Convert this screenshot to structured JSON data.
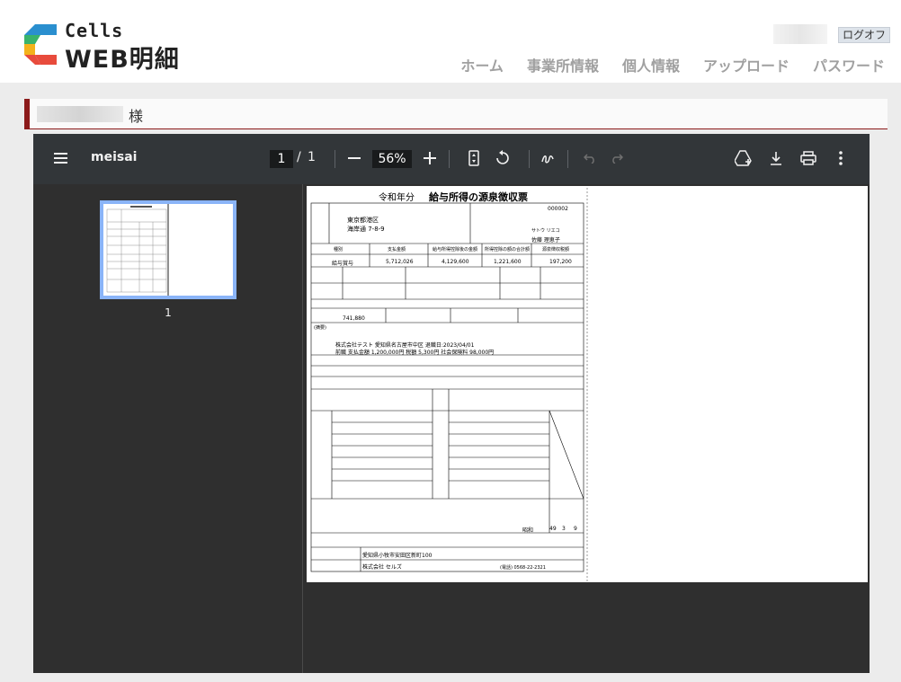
{
  "header": {
    "logo_small": "Cells",
    "logo_large": "WEB明細",
    "logout": "ログオフ",
    "nav": [
      "ホーム",
      "事業所情報",
      "個人情報",
      "アップロード",
      "パスワード"
    ]
  },
  "user": {
    "honorific": "様"
  },
  "viewer": {
    "filename": "meisai",
    "current_page": "1",
    "page_sep": "/",
    "total_pages": "1",
    "zoom": "56%",
    "thumb_label": "1"
  },
  "doc": {
    "era": "令和",
    "year_label": "年分",
    "title": "給与所得の源泉徴収票",
    "address1": "東京都港区",
    "address2": "海岸通 7-8-9",
    "name": "佐藤 理恵子",
    "kana": "サトウ リエコ",
    "emp_no": "000002",
    "pay_type": "給与賞与",
    "pay_amount": "5,712,026",
    "after_deduction": "4,129,600",
    "deduction_total": "1,221,600",
    "tax": "197,200",
    "social_ins": "741,880",
    "remark_label": "(摘要)",
    "remark1": "株式会社テスト 愛知県名古屋市中区 退職日:2023/04/01",
    "remark2": "前職 支払金額 1,200,000円 税額 5,300円 社会保険料 98,000円",
    "birth_era": "昭和",
    "birth_y": "49",
    "birth_m": "3",
    "birth_d": "9",
    "payer_address": "愛知県小牧市安田区新町100",
    "payer_name": "株式会社 セルズ",
    "payer_tel": "(電話) 0568-22-2321",
    "col_kind": "種別",
    "col_amount": "支払金額",
    "col_after": "給与所得控除後の金額",
    "col_deduct": "所得控除の額の合計額",
    "col_tax": "源泉徴収税額"
  }
}
